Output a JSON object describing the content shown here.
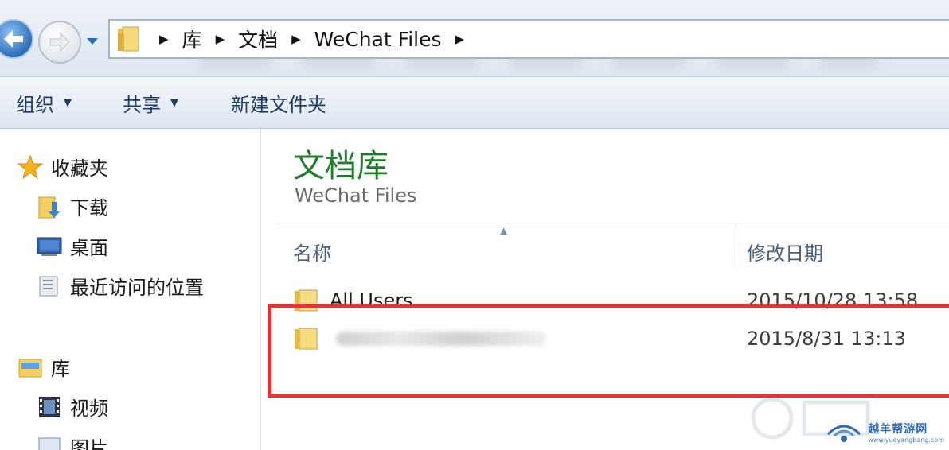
{
  "address_bar": {
    "crumbs": [
      "库",
      "文档",
      "WeChat Files"
    ]
  },
  "toolbar": {
    "organize": "组织",
    "share": "共享",
    "new_folder": "新建文件夹"
  },
  "nav": {
    "favorites": {
      "label": "收藏夹",
      "items": [
        "下载",
        "桌面",
        "最近访问的位置"
      ]
    },
    "libraries": {
      "label": "库",
      "items": [
        "视频",
        "图片"
      ]
    }
  },
  "content": {
    "library_title": "文档库",
    "library_subtitle": "WeChat Files",
    "columns": {
      "name": "名称",
      "date_modified": "修改日期"
    },
    "files": [
      {
        "name": "All Users",
        "date": "2015/10/28 13:58",
        "type": "folder"
      },
      {
        "name": "",
        "date": "2015/8/31 13:13",
        "type": "folder",
        "name_obscured": true
      }
    ]
  },
  "watermark": {
    "text": "越羊帮游网",
    "url": "www.yueyangbang.com"
  },
  "colors": {
    "library_title": "#1e7b2a",
    "highlight_box": "#e3343a",
    "toolbar_text": "#1f3b63"
  }
}
